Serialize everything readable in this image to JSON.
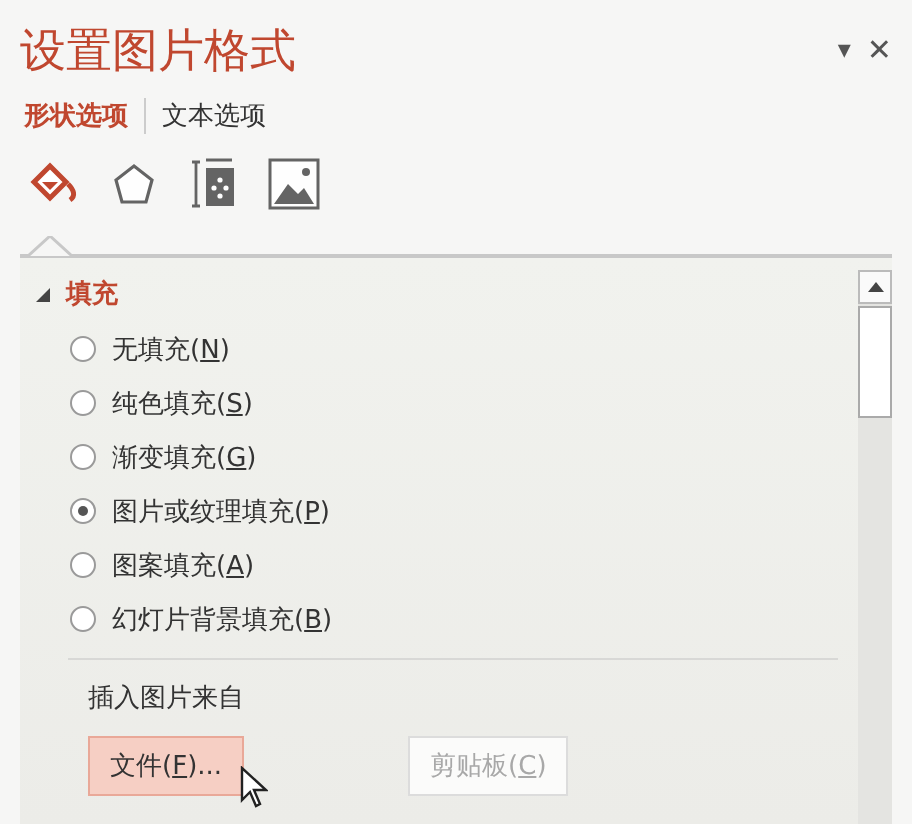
{
  "pane": {
    "title": "设置图片格式",
    "menu_glyph": "▾",
    "close_glyph": "✕"
  },
  "tabs": [
    {
      "label": "形状选项",
      "selected": true
    },
    {
      "label": "文本选项",
      "selected": false
    }
  ],
  "icon_tabs": [
    {
      "kind": "fill",
      "selected": true
    },
    {
      "kind": "shape",
      "selected": false
    },
    {
      "kind": "size",
      "selected": false
    },
    {
      "kind": "picture",
      "selected": false
    }
  ],
  "section": {
    "title": "填充",
    "expanded": true
  },
  "options": [
    {
      "label": "无填充(",
      "hotkey": "N",
      "tail": ")",
      "selected": false
    },
    {
      "label": "纯色填充(",
      "hotkey": "S",
      "tail": ")",
      "selected": false
    },
    {
      "label": "渐变填充(",
      "hotkey": "G",
      "tail": ")",
      "selected": false
    },
    {
      "label": "图片或纹理填充(",
      "hotkey": "P",
      "tail": ")",
      "selected": true
    },
    {
      "label": "图案填充(",
      "hotkey": "A",
      "tail": ")",
      "selected": false
    },
    {
      "label": "幻灯片背景填充(",
      "hotkey": "B",
      "tail": ")",
      "selected": false
    }
  ],
  "insert_from": {
    "label": "插入图片来自",
    "buttons": [
      {
        "label": "文件(",
        "hotkey": "F",
        "tail": ")...",
        "hovered": true,
        "disabled": false
      },
      {
        "label": "剪贴板(",
        "hotkey": "C",
        "tail": ")",
        "hovered": false,
        "disabled": true
      }
    ]
  }
}
